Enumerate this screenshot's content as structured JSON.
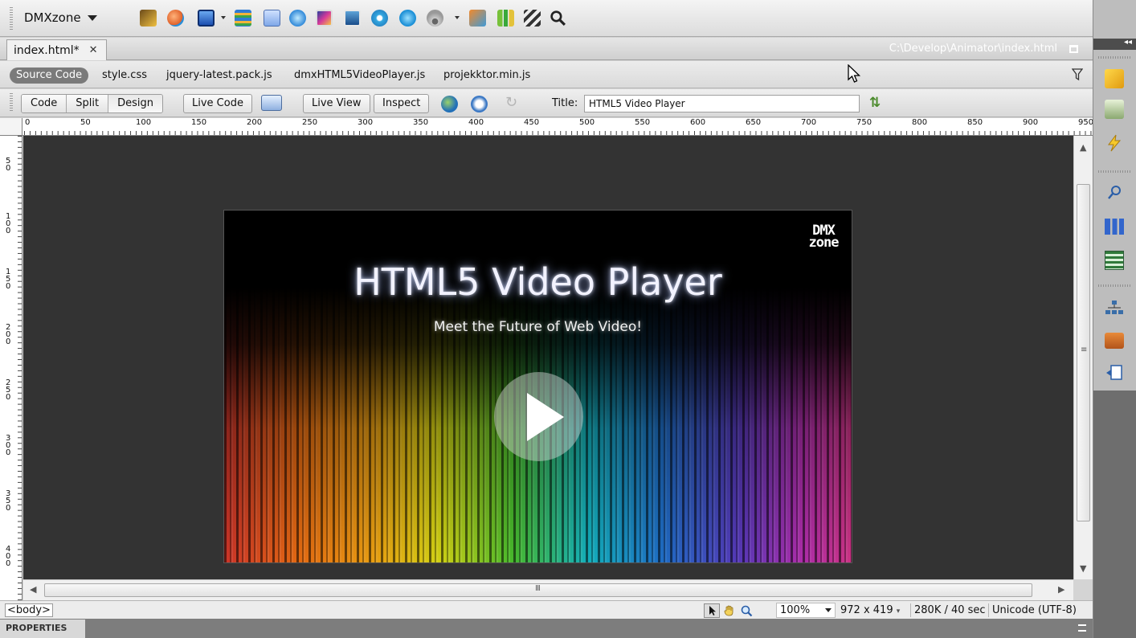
{
  "toolbar": {
    "menu_label": "DMXzone",
    "icons": [
      "animator-icon",
      "color-icon",
      "frame-icon",
      "layers-icon",
      "panel-icon",
      "box-icon",
      "image-icon",
      "photo-icon",
      "video-icon",
      "audio-icon",
      "gallery-icon",
      "chart-icon",
      "clapper-icon",
      "search-icon"
    ]
  },
  "document": {
    "tab_label": "index.html*",
    "path": "C:\\Develop\\Animator\\index.html"
  },
  "related_files": {
    "source_label": "Source Code",
    "files": [
      "style.css",
      "jquery-latest.pack.js",
      "dmxHTML5VideoPlayer.js",
      "projekktor.min.js"
    ]
  },
  "doc_toolbar": {
    "view_buttons": [
      "Code",
      "Split",
      "Design"
    ],
    "active_view": "Design",
    "live_code_label": "Live Code",
    "live_view_label": "Live View",
    "inspect_label": "Inspect",
    "title_label": "Title:",
    "title_value": "HTML5 Video Player"
  },
  "ruler": {
    "h_marks": [
      "0",
      "50",
      "100",
      "150",
      "200",
      "250",
      "300",
      "350",
      "400",
      "450",
      "500",
      "550",
      "600",
      "650",
      "700",
      "750",
      "800",
      "850",
      "900",
      "950"
    ],
    "v_marks": [
      "50",
      "100",
      "150",
      "200",
      "250",
      "300",
      "350",
      "400"
    ]
  },
  "video": {
    "title": "HTML5 Video Player",
    "subtitle": "Meet the Future of Web Video!",
    "logo_text": "DMX",
    "logo_text2": "zone"
  },
  "status": {
    "tag": "<body>",
    "zoom": "100%",
    "dimensions": "972 x 419",
    "download": "280K / 40 sec",
    "encoding": "Unicode (UTF-8)"
  },
  "properties": {
    "label": "PROPERTIES"
  },
  "colors": {
    "canvas": "#333333",
    "pill": "#7a7a7a",
    "properties_bar": "#7d7d7d"
  }
}
